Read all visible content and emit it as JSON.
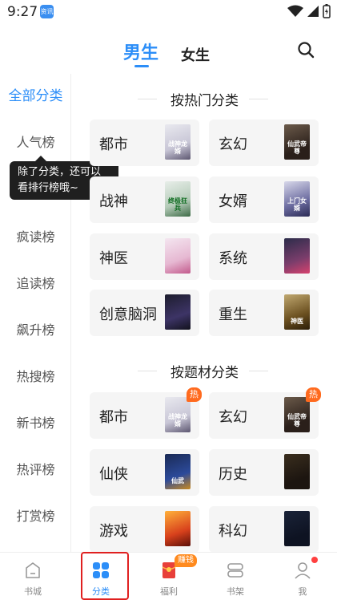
{
  "status": {
    "time": "9:27",
    "app_badge": "资讯"
  },
  "tabs": {
    "male": "男生",
    "female": "女生"
  },
  "sidebar": {
    "items": [
      {
        "label": "全部分类"
      },
      {
        "label": "人气榜"
      },
      {
        "label": "疯读榜"
      },
      {
        "label": "追读榜"
      },
      {
        "label": "飙升榜"
      },
      {
        "label": "热搜榜"
      },
      {
        "label": "新书榜"
      },
      {
        "label": "热评榜"
      },
      {
        "label": "打赏榜"
      }
    ]
  },
  "tooltip": {
    "text": "除了分类，还可以看排行榜哦~"
  },
  "hot_section": {
    "title": "按热门分类",
    "cards": [
      {
        "label": "都市",
        "cover_text": "战神龙婿"
      },
      {
        "label": "玄幻",
        "cover_text": "仙武帝尊"
      },
      {
        "label": "战神",
        "cover_text": "终极狂兵"
      },
      {
        "label": "女婿",
        "cover_text": "上门女婿"
      },
      {
        "label": "神医",
        "cover_text": ""
      },
      {
        "label": "系统",
        "cover_text": ""
      },
      {
        "label": "创意脑洞",
        "cover_text": ""
      },
      {
        "label": "重生",
        "cover_text": "神医"
      }
    ]
  },
  "theme_section": {
    "title": "按题材分类",
    "hot_badge": "热",
    "cards": [
      {
        "label": "都市",
        "cover_text": "战神龙婿"
      },
      {
        "label": "玄幻",
        "cover_text": "仙武帝尊"
      },
      {
        "label": "仙侠",
        "cover_text": "仙武"
      },
      {
        "label": "历史",
        "cover_text": ""
      },
      {
        "label": "游戏",
        "cover_text": ""
      },
      {
        "label": "科幻",
        "cover_text": ""
      }
    ]
  },
  "bottom_nav": {
    "items": [
      {
        "label": "书城"
      },
      {
        "label": "分类"
      },
      {
        "label": "福利"
      },
      {
        "label": "书架"
      },
      {
        "label": "我"
      }
    ],
    "earn_badge": "赚钱"
  },
  "colors": {
    "accent": "#2c8ef8",
    "hot": "#ff6a1e",
    "highlight": "#e02020"
  }
}
